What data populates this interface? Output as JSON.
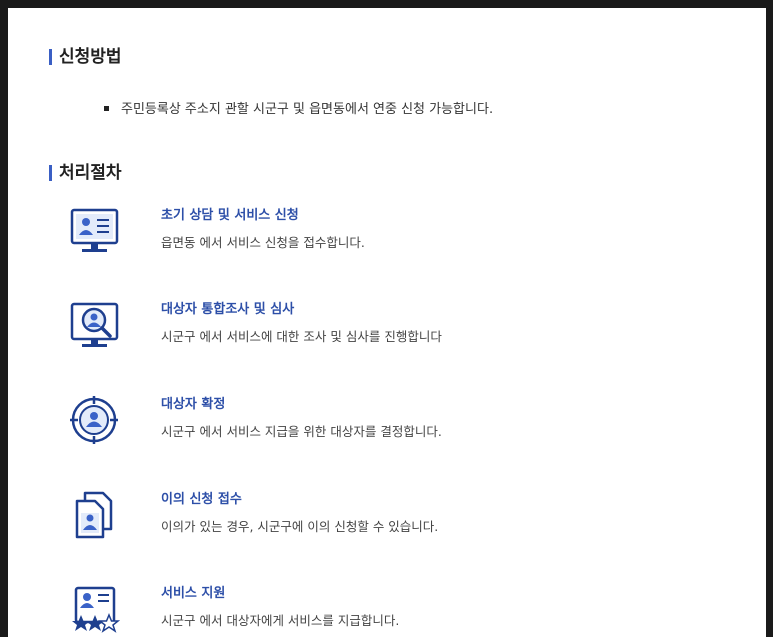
{
  "application": {
    "title": "신청방법",
    "items": [
      "주민등록상 주소지 관할 시군구 및 읍면동에서 연중 신청 가능합니다."
    ]
  },
  "procedure": {
    "title": "처리절차",
    "steps": [
      {
        "title": "초기 상담 및 서비스 신청",
        "desc": "읍면동 에서 서비스 신청을 접수합니다.",
        "icon": "monitor-profile-icon"
      },
      {
        "title": "대상자 통합조사 및 심사",
        "desc": "시군구 에서 서비스에 대한 조사 및 심사를 진행합니다",
        "icon": "monitor-search-person-icon"
      },
      {
        "title": "대상자 확정",
        "desc": "시군구 에서 서비스 지급을 위한 대상자를 결정합니다.",
        "icon": "target-person-icon"
      },
      {
        "title": "이의 신청 접수",
        "desc": "이의가 있는 경우, 시군구에 이의 신청할 수 있습니다.",
        "icon": "documents-person-icon"
      },
      {
        "title": "서비스 지원",
        "desc": "시군구 에서 대상자에게 서비스를 지급합니다.",
        "icon": "profile-card-stars-icon"
      }
    ]
  },
  "colors": {
    "accent": "#3a5fc4",
    "icon_primary": "#1e3f8f",
    "step_title": "#2d4fa8"
  }
}
